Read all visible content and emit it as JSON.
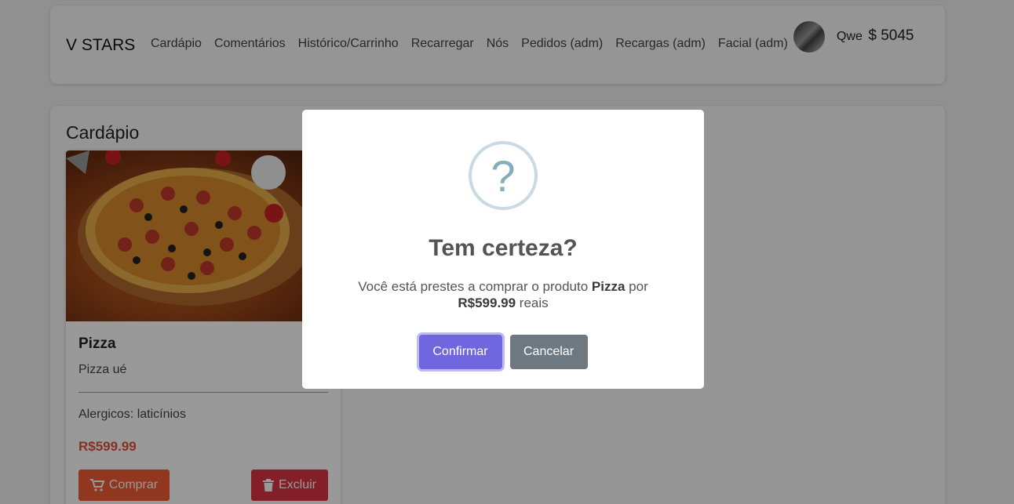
{
  "navbar": {
    "brand": "V STARS",
    "links": [
      "Cardápio",
      "Comentários",
      "Histórico/Carrinho",
      "Recarregar",
      "Nós",
      "Pedidos (adm)",
      "Recargas (adm)",
      "Facial (adm)"
    ],
    "user_name": "Qwe",
    "balance": "$ 5045"
  },
  "page": {
    "title": "Cardápio"
  },
  "product": {
    "name": "Pizza",
    "description": "Pizza ué",
    "allergens": "Alergicos: laticínios",
    "price": "R$599.99",
    "buy_label": "Comprar",
    "delete_label": "Excluir"
  },
  "modal": {
    "icon_glyph": "?",
    "title": "Tem certeza?",
    "text_prefix": "Você está prestes a comprar o produto ",
    "product": "Pizza",
    "text_mid": " por ",
    "price": "R$599.99",
    "text_suffix": " reais",
    "confirm_label": "Confirmar",
    "cancel_label": "Cancelar"
  },
  "colors": {
    "buy": "#f25a35",
    "delete": "#dc3545",
    "confirm": "#7066e0",
    "cancel": "#6e7881",
    "price": "#e0503a"
  }
}
